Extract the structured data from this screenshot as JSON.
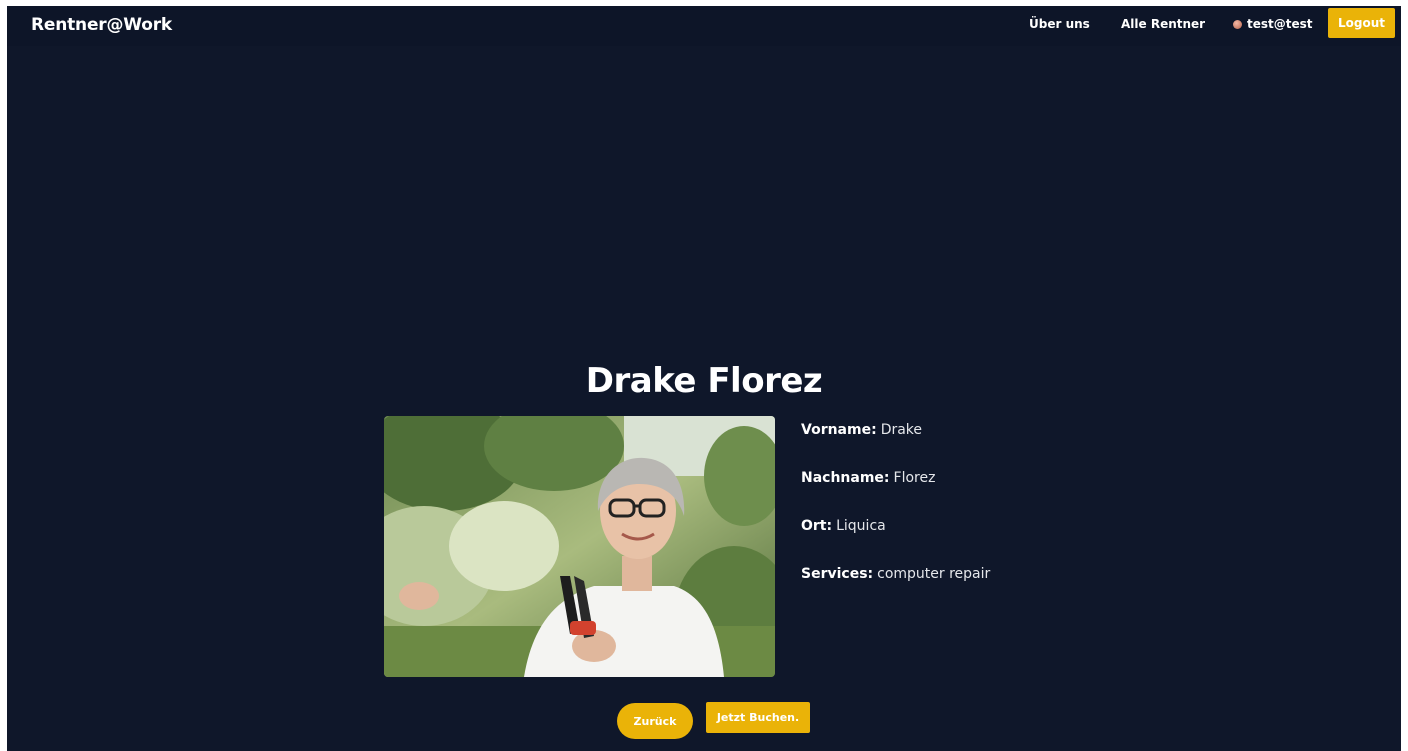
{
  "navbar": {
    "brand": "Rentner@Work",
    "links": {
      "about": "Über uns",
      "all_retirees": "Alle Rentner"
    },
    "user": {
      "email": "test@test",
      "icon": "avatar-icon"
    },
    "logout_label": "Logout"
  },
  "profile": {
    "name": "Drake Florez",
    "photo_icon": "profile-photo",
    "fields": {
      "vorname": {
        "label": "Vorname:",
        "value": "Drake"
      },
      "nachname": {
        "label": "Nachname:",
        "value": "Florez"
      },
      "ort": {
        "label": "Ort:",
        "value": "Liquica"
      },
      "services": {
        "label": "Services:",
        "value": "computer repair"
      }
    }
  },
  "actions": {
    "back_label": "Zurück",
    "book_label": "Jetzt Buchen."
  },
  "colors": {
    "background": "#0f172a",
    "accent": "#eab308",
    "text": "#ffffff"
  }
}
